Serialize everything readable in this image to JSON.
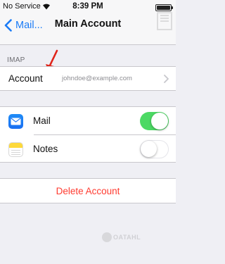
{
  "status_bar": {
    "carrier": "No Service",
    "time": "8:39 PM"
  },
  "nav": {
    "back_label": "Mail...",
    "title": "Main Account"
  },
  "imap_section": {
    "header": "IMAP",
    "account_label": "Account",
    "account_value": "johndoe@example.com"
  },
  "apps": [
    {
      "label": "Mail",
      "icon": "mail-icon",
      "enabled": true
    },
    {
      "label": "Notes",
      "icon": "notes-icon",
      "enabled": false
    }
  ],
  "delete_button": {
    "label": "Delete Account"
  },
  "watermark": {
    "text": "OATAHL"
  },
  "colors": {
    "accent": "#1b7cf6",
    "toggle_on": "#4cd964",
    "destructive": "#ff3b30",
    "annotation_arrow": "#e0241a"
  }
}
